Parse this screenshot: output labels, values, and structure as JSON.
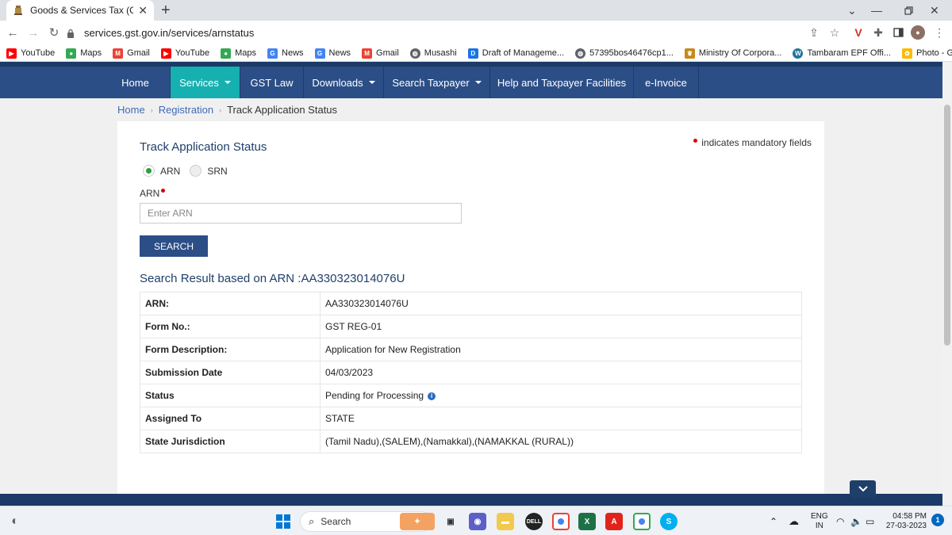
{
  "browser": {
    "tab_title": "Goods & Services Tax (GST) | Trac",
    "url": "services.gst.gov.in/services/arnstatus"
  },
  "bookmarks": [
    {
      "label": "YouTube",
      "icon": "youtube-icon",
      "color": "#ff0000"
    },
    {
      "label": "Maps",
      "icon": "maps-icon",
      "color": "#34a853"
    },
    {
      "label": "Gmail",
      "icon": "gmail-icon",
      "color": "#ea4335"
    },
    {
      "label": "YouTube",
      "icon": "youtube-icon",
      "color": "#ff0000"
    },
    {
      "label": "Maps",
      "icon": "maps-icon",
      "color": "#34a853"
    },
    {
      "label": "News",
      "icon": "news-icon",
      "color": "#4285f4"
    },
    {
      "label": "News",
      "icon": "news-icon",
      "color": "#4285f4"
    },
    {
      "label": "Gmail",
      "icon": "gmail-icon",
      "color": "#ea4335"
    },
    {
      "label": "Musashi",
      "icon": "globe-icon",
      "color": "#5f6368"
    },
    {
      "label": "Draft of Manageme...",
      "icon": "doc-icon",
      "color": "#1a73e8"
    },
    {
      "label": "57395bos46476cp1...",
      "icon": "globe-icon",
      "color": "#5f6368"
    },
    {
      "label": "Ministry Of Corpora...",
      "icon": "emblem-icon",
      "color": "#c58a1a"
    },
    {
      "label": "Tambaram EPF Offi...",
      "icon": "wordpress-icon",
      "color": "#21759b"
    },
    {
      "label": "Photo - Google Ph...",
      "icon": "photos-icon",
      "color": "#fbbc04"
    }
  ],
  "nav": {
    "items": [
      "Home",
      "Services",
      "GST Law",
      "Downloads",
      "Search Taxpayer",
      "Help and Taxpayer Facilities",
      "e-Invoice"
    ]
  },
  "breadcrumb": {
    "home": "Home",
    "registration": "Registration",
    "current": "Track Application Status"
  },
  "form": {
    "title": "Track Application Status",
    "mandatory_note": "indicates mandatory fields",
    "radio_arn": "ARN",
    "radio_srn": "SRN",
    "arn_label": "ARN",
    "arn_placeholder": "Enter ARN",
    "search_label": "SEARCH"
  },
  "result": {
    "title_prefix": "Search Result based on ARN : ",
    "arn": "AA330323014076U",
    "rows": [
      {
        "key": "ARN:",
        "value": "AA330323014076U"
      },
      {
        "key": "Form No.:",
        "value": "GST REG-01"
      },
      {
        "key": "Form Description:",
        "value": "Application for New Registration"
      },
      {
        "key": "Submission Date",
        "value": "04/03/2023"
      },
      {
        "key": "Status",
        "value": "Pending for Processing"
      },
      {
        "key": "Assigned To",
        "value": "STATE"
      },
      {
        "key": "State Jurisdiction",
        "value": "(Tamil Nadu),(SALEM),(Namakkal),(NAMAKKAL (RURAL))"
      }
    ]
  },
  "taskbar": {
    "search_label": "Search",
    "lang_top": "ENG",
    "lang_bottom": "IN",
    "time": "04:58 PM",
    "date": "27-03-2023",
    "notification_count": "1"
  },
  "colors": {
    "nav_bg": "#2c4e86",
    "nav_active": "#17b0b0",
    "accent_green": "#2e9e3e",
    "required_red": "#dd0000"
  }
}
